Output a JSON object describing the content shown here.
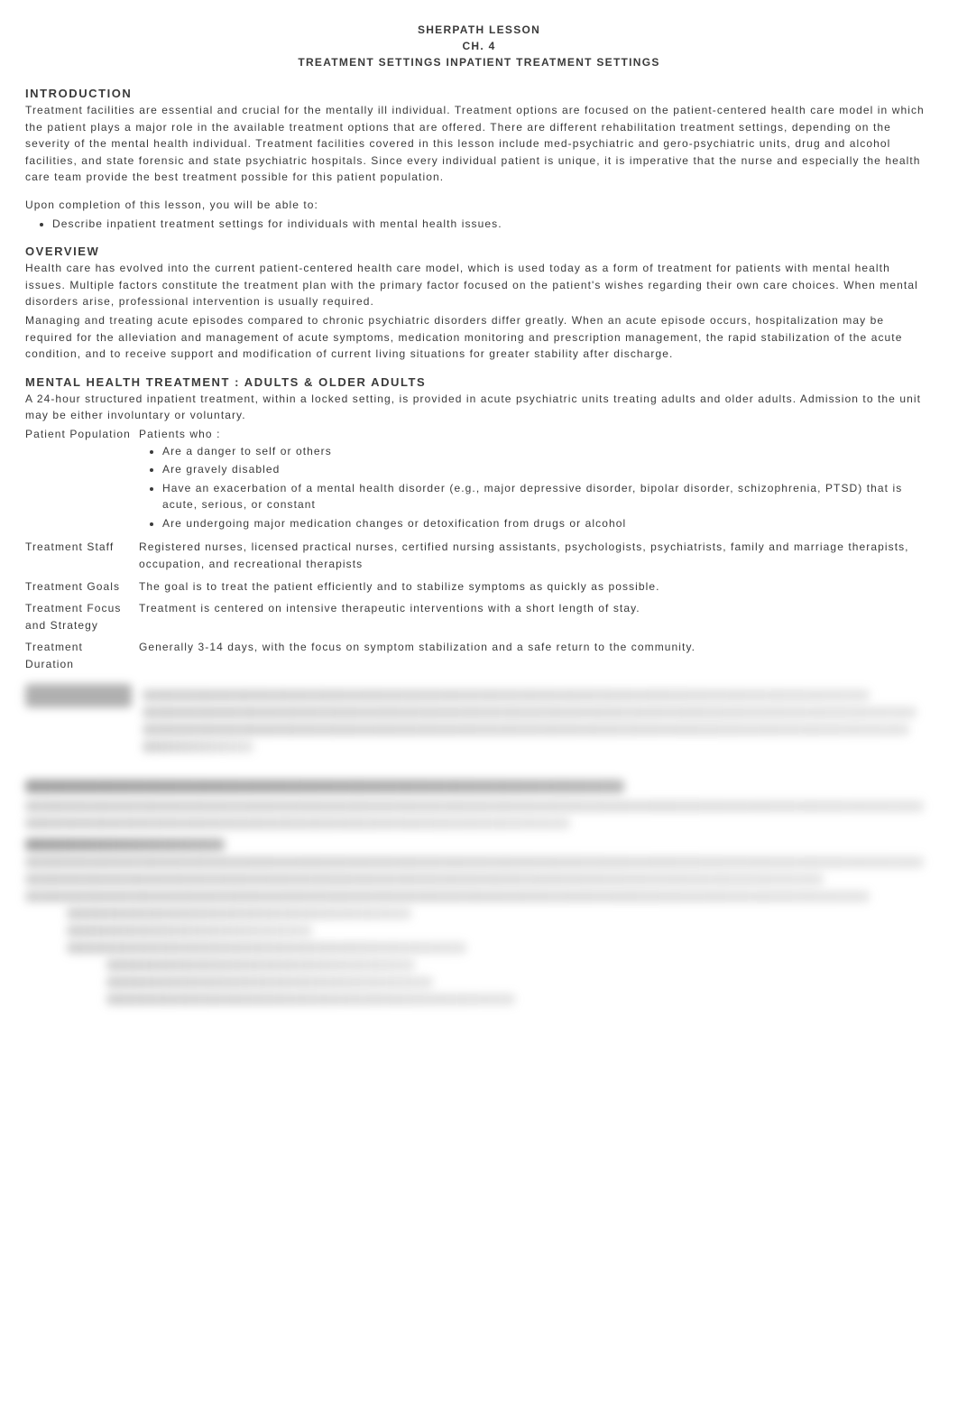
{
  "header": {
    "line1": "SHERPATH LESSON",
    "line2": "CH. 4",
    "line3": "TREATMENT SETTINGS INPATIENT TREATMENT SETTINGS"
  },
  "sections": {
    "introduction": {
      "title": "INTRODUCTION",
      "para1": "Treatment facilities are essential and crucial for the mentally ill individual. Treatment options are focused on the patient-centered health care model in which the patient plays a major role in the available treatment options that are offered. There are different rehabilitation treatment settings, depending on the severity of the mental health individual. Treatment facilities covered in this lesson include med-psychiatric and gero-psychiatric units, drug and alcohol facilities, and state forensic and state psychiatric hospitals. Since every individual patient is unique, it is imperative that the nurse and especially the health care team provide the best treatment possible for this patient population.",
      "para2": "Upon completion of this lesson, you will be able to:",
      "bullets": [
        "Describe inpatient treatment settings for individuals with mental health issues."
      ]
    },
    "overview": {
      "title": "OVERVIEW",
      "para1": "Health care has evolved into the current patient-centered health care model, which is used today as a form of treatment for patients with mental health issues. Multiple factors constitute the treatment plan with the primary factor focused on the patient's wishes regarding their own care choices. When mental disorders arise, professional intervention is usually required.",
      "para2": "Managing and treating acute episodes compared to chronic psychiatric disorders differ greatly. When an acute episode occurs, hospitalization may be required for the alleviation and management of acute symptoms, medication monitoring and prescription management, the rapid stabilization of the acute condition, and to receive support and modification of current living situations for greater stability after discharge."
    },
    "adults": {
      "title": "MENTAL HEALTH TREATMENT : ADULTS & OLDER ADULTS",
      "intro": "A 24-hour structured inpatient treatment, within a locked setting, is provided in acute psychiatric units treating adults and older adults. Admission to the unit may be either involuntary or voluntary.",
      "rows": {
        "patient_population": {
          "label": "Patient Population",
          "lead": "Patients who :",
          "items": [
            "Are a danger to self or others",
            "Are gravely disabled",
            "Have an exacerbation of a mental health disorder (e.g., major depressive disorder, bipolar disorder, schizophrenia, PTSD) that is acute, serious, or constant",
            "Are undergoing major medication changes or detoxification from drugs or alcohol"
          ]
        },
        "treatment_staff": {
          "label": "Treatment Staff",
          "text": "Registered nurses, licensed practical nurses, certified nursing assistants, psychologists, psychiatrists, family and marriage therapists, occupation, and recreational therapists"
        },
        "treatment_goals": {
          "label": "Treatment Goals",
          "text": "The goal is to treat the patient efficiently and to stabilize symptoms as quickly as possible."
        },
        "treatment_focus": {
          "label": "Treatment Focus and Strategy",
          "text": "Treatment is centered on intensive therapeutic interventions with a short length of stay."
        },
        "treatment_duration": {
          "label": "Treatment Duration",
          "text": "Generally 3-14 days, with the focus on symptom stabilization and a safe return to the community."
        }
      }
    }
  }
}
